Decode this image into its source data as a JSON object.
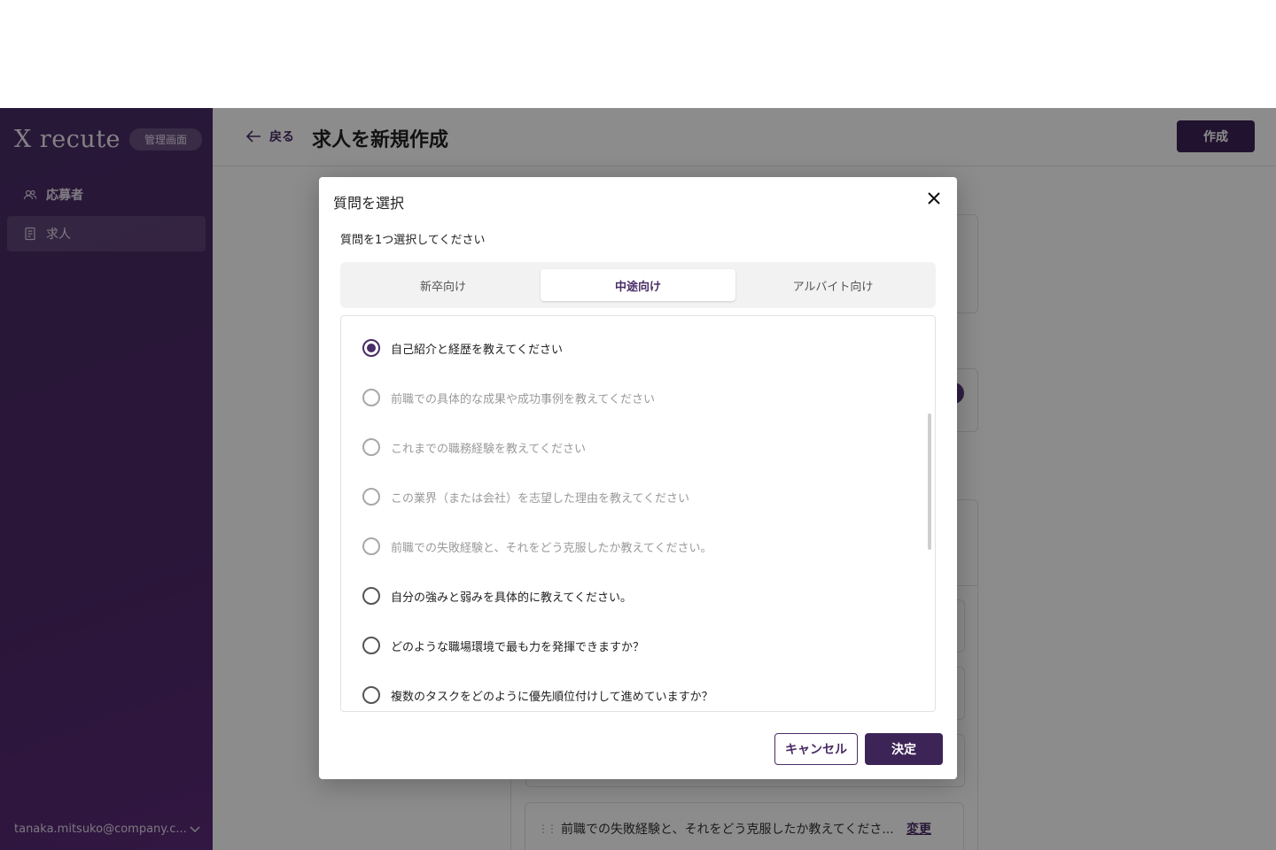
{
  "sidebar": {
    "brand": "X recute",
    "badge": "管理画面",
    "items": [
      {
        "label": "応募者",
        "icon": "users-icon"
      },
      {
        "label": "求人",
        "icon": "document-icon"
      }
    ],
    "user_email": "tanaka.mitsuko@company.c..."
  },
  "header": {
    "back_label": "戻る",
    "title": "求人を新規作成",
    "create_label": "作成"
  },
  "background": {
    "question_row_text": "前職での失敗経験と、それをどう克服したか教えてくださ...",
    "question_row_action": "変更"
  },
  "modal": {
    "title": "質問を選択",
    "description": "質問を1つ選択してください",
    "tabs": [
      "新卒向け",
      "中途向け",
      "アルバイト向け"
    ],
    "active_tab": "中途向け",
    "options": [
      {
        "label": "自己紹介と経歴を教えてください",
        "state": "selected"
      },
      {
        "label": "前職での具体的な成果や成功事例を教えてください",
        "state": "disabled"
      },
      {
        "label": "これまでの職務経験を教えてください",
        "state": "disabled"
      },
      {
        "label": "この業界（または会社）を志望した理由を教えてください",
        "state": "disabled"
      },
      {
        "label": "前職での失敗経験と、それをどう克服したか教えてください。",
        "state": "disabled"
      },
      {
        "label": "自分の強みと弱みを具体的に教えてください。",
        "state": "enabled"
      },
      {
        "label": "どのような職場環境で最も力を発揮できますか？",
        "state": "enabled"
      },
      {
        "label": "複数のタスクをどのように優先順位付けして進めていますか？",
        "state": "enabled"
      }
    ],
    "cancel_label": "キャンセル",
    "confirm_label": "決定"
  },
  "colors": {
    "brand": "#4a2c66",
    "primary_button": "#3d2456"
  }
}
